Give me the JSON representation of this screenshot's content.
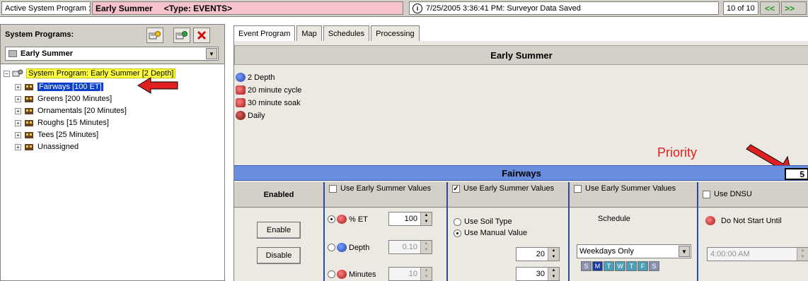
{
  "topbar": {
    "label": "Active System Program :",
    "program_name": "Early Summer",
    "program_type": "<Type: EVENTS>",
    "status_text": "7/25/2005 3:36:41 PM: Surveyor Data Saved",
    "count": "10 of 10",
    "prev_label": "<<",
    "next_label": ">>"
  },
  "left_panel": {
    "title": "System Programs:",
    "selected_program": "Early Summer",
    "tree": {
      "root": "System Program: Early Summer  [2 Depth]",
      "items": [
        {
          "label": "Fairways  [100 ET]",
          "selected": true
        },
        {
          "label": "Greens  [200 Minutes]"
        },
        {
          "label": "Ornamentals  [20 Minutes]"
        },
        {
          "label": "Roughs  [15 Minutes]"
        },
        {
          "label": "Tees  [25 Minutes]"
        },
        {
          "label": "Unassigned"
        }
      ]
    }
  },
  "tabs": [
    {
      "label": "Event Program",
      "active": true
    },
    {
      "label": "Map"
    },
    {
      "label": "Schedules"
    },
    {
      "label": "Processing"
    }
  ],
  "main": {
    "header": "Early Summer",
    "summary": [
      {
        "label": "2 Depth",
        "icon": "depth-icon",
        "color": "#3060c0"
      },
      {
        "label": "20 minute cycle",
        "icon": "cycle-icon",
        "color": "#c03030"
      },
      {
        "label": "30 minute soak",
        "icon": "soak-icon",
        "color": "#c03030"
      },
      {
        "label": "Daily",
        "icon": "daily-icon",
        "color": "#a02020"
      }
    ],
    "priority_label": "Priority",
    "section_title": "Fairways",
    "priority_value": "5"
  },
  "columns": {
    "enabled": {
      "title": "Enabled",
      "enable_label": "Enable",
      "disable_label": "Disable"
    },
    "amount": {
      "use_values_label": "Use Early Summer Values",
      "use_values_checked": false,
      "et_label": "% ET",
      "et_value": "100",
      "depth_label": "Depth",
      "depth_value": "0.10",
      "minutes_label": "Minutes",
      "minutes_value": "10",
      "selected": "et"
    },
    "cycle": {
      "use_values_label": "Use Early Summer Values",
      "use_values_checked": true,
      "check_mark": "✓",
      "soil_type_label": "Use Soil Type",
      "manual_value_label": "Use Manual Value",
      "selected": "manual",
      "cycle_value": "20",
      "soak_value": "30"
    },
    "schedule": {
      "use_values_label": "Use Early Summer Values",
      "use_values_checked": false,
      "schedule_label": "Schedule",
      "schedule_value": "Weekdays Only",
      "days": [
        "S",
        "M",
        "T",
        "W",
        "T",
        "F",
        "S"
      ]
    },
    "dnsu": {
      "use_label": "Use DNSU",
      "use_checked": false,
      "do_not_start_label": "Do Not Start Until",
      "time_value": "4:00:00 AM"
    }
  },
  "colors": {
    "program_bar": "#f6c3cd",
    "section_header": "#6a8ede",
    "column_divider": "#2a4aa8",
    "selected_node": "#0a3fc8",
    "root_highlight": "#ffff40",
    "annotation_red": "#e02020"
  }
}
